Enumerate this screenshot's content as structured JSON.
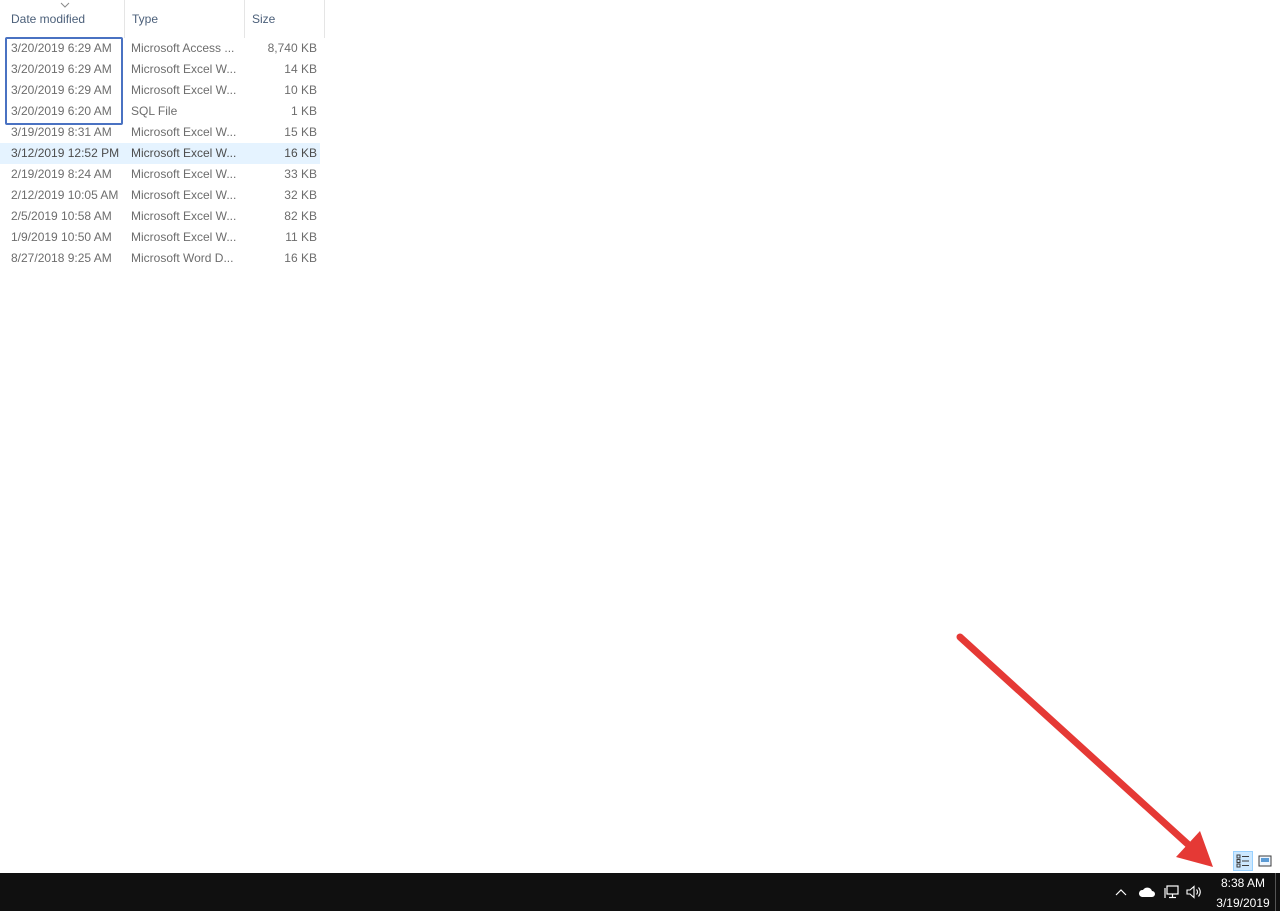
{
  "columns": {
    "date_modified": "Date modified",
    "type": "Type",
    "size": "Size"
  },
  "files": [
    {
      "date": "3/20/2019 6:29 AM",
      "type": "Microsoft Access ...",
      "size": "8,740 KB",
      "selected": false
    },
    {
      "date": "3/20/2019 6:29 AM",
      "type": "Microsoft Excel W...",
      "size": "14 KB",
      "selected": false
    },
    {
      "date": "3/20/2019 6:29 AM",
      "type": "Microsoft Excel W...",
      "size": "10 KB",
      "selected": false
    },
    {
      "date": "3/20/2019 6:20 AM",
      "type": "SQL File",
      "size": "1 KB",
      "selected": false
    },
    {
      "date": "3/19/2019 8:31 AM",
      "type": "Microsoft Excel W...",
      "size": "15 KB",
      "selected": false
    },
    {
      "date": "3/12/2019 12:52 PM",
      "type": "Microsoft Excel W...",
      "size": "16 KB",
      "selected": true
    },
    {
      "date": "2/19/2019 8:24 AM",
      "type": "Microsoft Excel W...",
      "size": "33 KB",
      "selected": false
    },
    {
      "date": "2/12/2019 10:05 AM",
      "type": "Microsoft Excel W...",
      "size": "32 KB",
      "selected": false
    },
    {
      "date": "2/5/2019 10:58 AM",
      "type": "Microsoft Excel W...",
      "size": "82 KB",
      "selected": false
    },
    {
      "date": "1/9/2019 10:50 AM",
      "type": "Microsoft Excel W...",
      "size": "11 KB",
      "selected": false
    },
    {
      "date": "8/27/2018 9:25 AM",
      "type": "Microsoft Word D...",
      "size": "16 KB",
      "selected": false
    }
  ],
  "sort": {
    "column": "date_modified",
    "icon": "chevron-down-icon"
  },
  "annotations": {
    "highlight_color": "#4a72c2",
    "arrow_color": "#e53935"
  },
  "view_toggle": {
    "details_icon": "details-view-icon",
    "thumbnails_icon": "large-icons-view-icon",
    "active": "details"
  },
  "taskbar": {
    "tray_icons": [
      "chevron-up-icon",
      "onedrive-cloud-icon",
      "network-icon",
      "volume-icon"
    ],
    "time": "8:38 AM",
    "date": "3/19/2019",
    "background": "#101010"
  }
}
